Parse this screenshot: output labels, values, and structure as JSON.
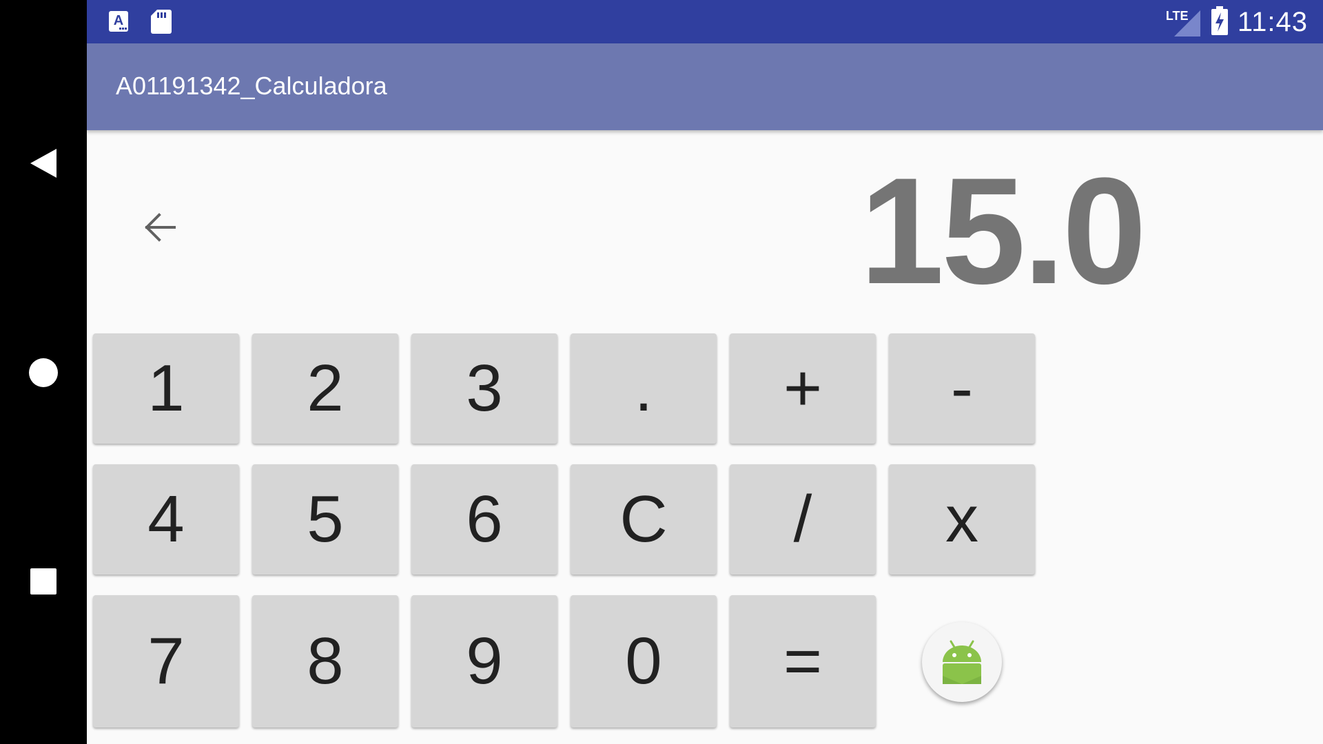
{
  "status_bar": {
    "time": "11:43",
    "network_label": "LTE",
    "icons": [
      "keyboard-a-icon",
      "sd-card-icon",
      "signal-icon",
      "battery-charging-icon"
    ]
  },
  "app_bar": {
    "title": "A01191342_Calculadora"
  },
  "display": {
    "value": "15.0"
  },
  "keypad": {
    "row1": [
      "1",
      "2",
      "3",
      ".",
      "+",
      "-"
    ],
    "row2": [
      "4",
      "5",
      "6",
      "C",
      "/",
      "x"
    ],
    "row3": [
      "7",
      "8",
      "9",
      "0",
      "="
    ]
  },
  "colors": {
    "status_bar": "#303f9f",
    "app_bar": "#6d78b0",
    "key": "#d6d6d6",
    "display_text": "#757575",
    "android_green": "#8bc34a"
  }
}
